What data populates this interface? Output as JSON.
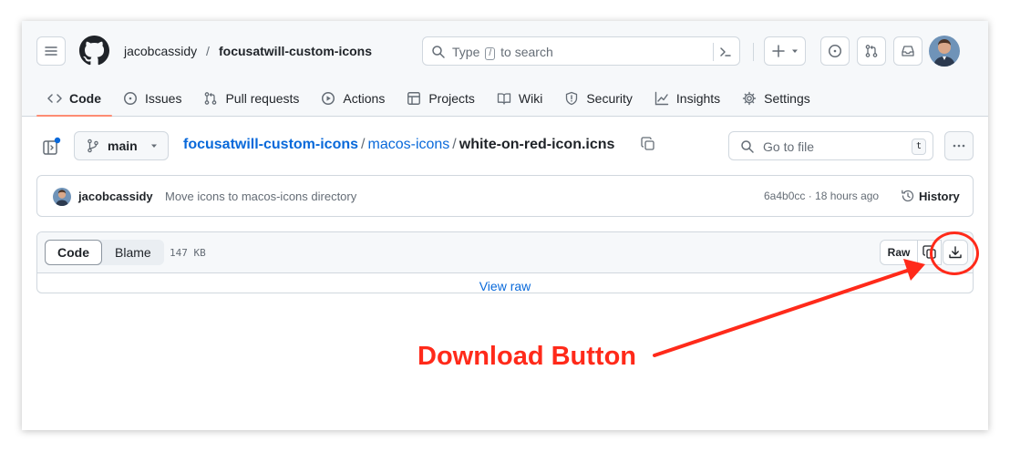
{
  "header": {
    "owner": "jacobcassidy",
    "separator": "/",
    "repo": "focusatwill-custom-icons",
    "search_prefix": "Type",
    "search_key": "/",
    "search_suffix": "to search"
  },
  "nav": {
    "items": [
      {
        "label": "Code",
        "icon": "code-icon",
        "active": true
      },
      {
        "label": "Issues",
        "icon": "issue-opened-icon"
      },
      {
        "label": "Pull requests",
        "icon": "git-pull-request-icon"
      },
      {
        "label": "Actions",
        "icon": "play-icon"
      },
      {
        "label": "Projects",
        "icon": "table-icon"
      },
      {
        "label": "Wiki",
        "icon": "book-icon"
      },
      {
        "label": "Security",
        "icon": "shield-icon"
      },
      {
        "label": "Insights",
        "icon": "graph-icon"
      },
      {
        "label": "Settings",
        "icon": "gear-icon"
      }
    ]
  },
  "file_nav": {
    "branch": "main",
    "path_repo": "focusatwill-custom-icons",
    "path_dir": "macos-icons",
    "path_file": "white-on-red-icon.icns",
    "sep": "/",
    "goto_placeholder": "Go to file",
    "goto_key": "t"
  },
  "commit": {
    "author": "jacobcassidy",
    "message": "Move icons to macos-icons directory",
    "meta": "6a4b0cc · 18 hours ago",
    "history_label": "History"
  },
  "file_view": {
    "tab_code": "Code",
    "tab_blame": "Blame",
    "size": "147 KB",
    "raw_label": "Raw",
    "view_raw": "View raw"
  },
  "annotation": {
    "label": "Download Button",
    "color": "#ff2a1a"
  },
  "colors": {
    "link": "#0969da",
    "active_tab_underline": "#fd8c73",
    "border": "#d0d7de"
  }
}
